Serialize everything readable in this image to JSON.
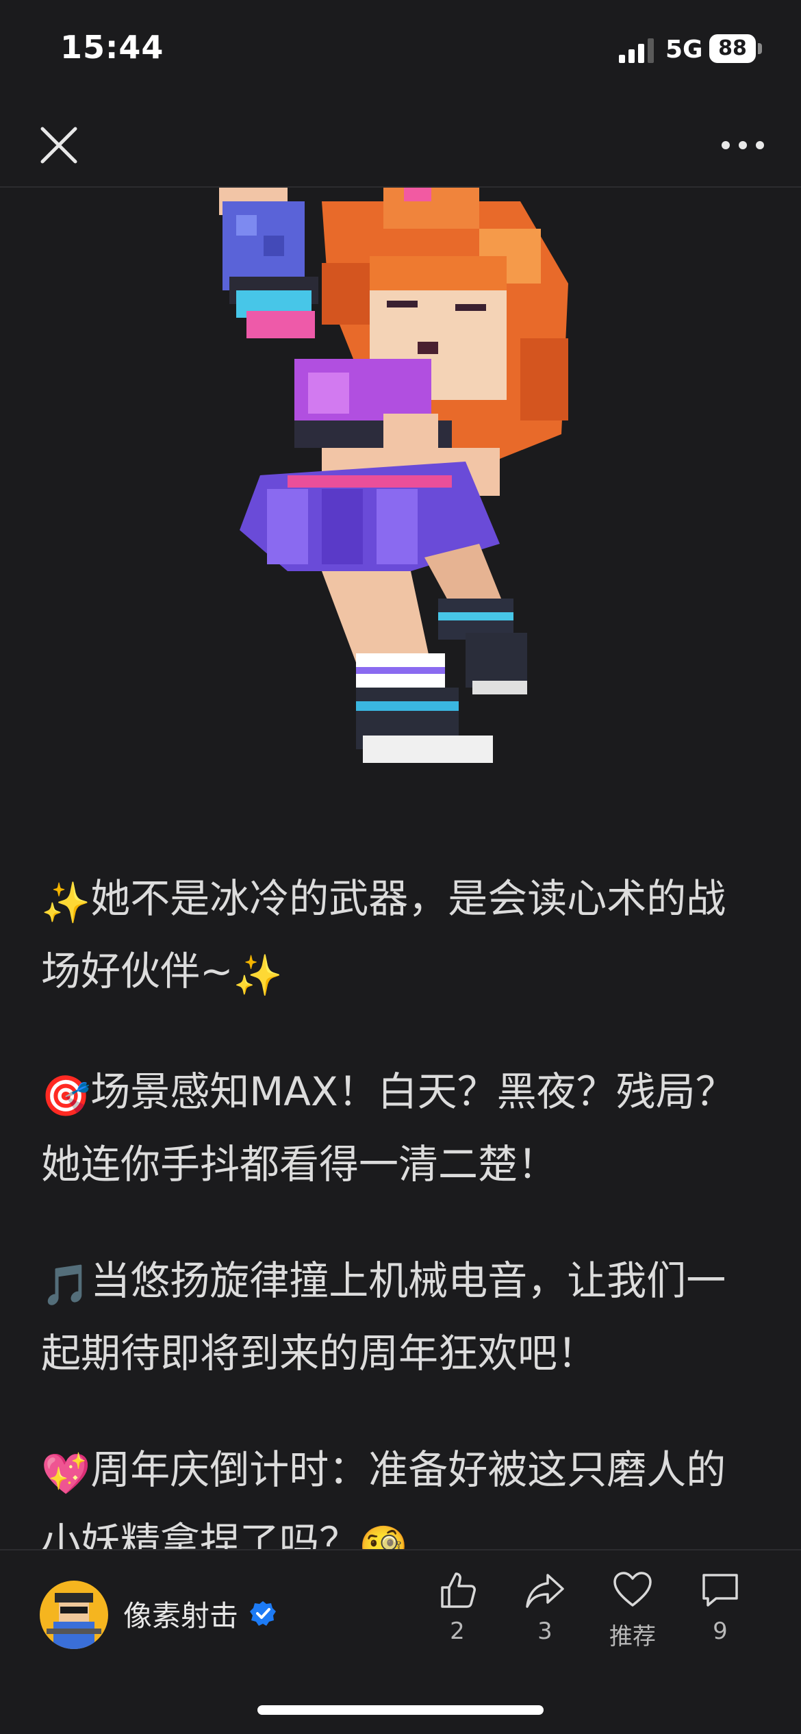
{
  "status_bar": {
    "time": "15:44",
    "network": "5G",
    "battery": "88"
  },
  "nav": {
    "close_icon": "close-icon",
    "more_icon": "more-icon"
  },
  "post": {
    "paragraphs": [
      {
        "emoji": "✨",
        "text": "她不是冰冷的武器，是会读心术的战场好伙伴~",
        "trail_emoji": "✨"
      },
      {
        "emoji": "🎯",
        "text": "场景感知MAX！白天？黑夜？残局？她连你手抖都看得一清二楚！",
        "trail_emoji": ""
      },
      {
        "emoji": "🎵",
        "text": "当悠扬旋律撞上机械电音，让我们一起期待即将到来的周年狂欢吧！",
        "trail_emoji": ""
      },
      {
        "emoji": "💖",
        "text": "周年庆倒计时：准备好被这只磨人的小妖精拿捏了吗？",
        "trail_emoji": "🧐"
      }
    ]
  },
  "author": {
    "name": "像素射击"
  },
  "actions": {
    "like_count": "2",
    "share_count": "3",
    "recommend_label": "推荐",
    "comment_count": "9"
  },
  "colors": {
    "background": "#1b1b1d",
    "verified": "#1d7bf5"
  }
}
